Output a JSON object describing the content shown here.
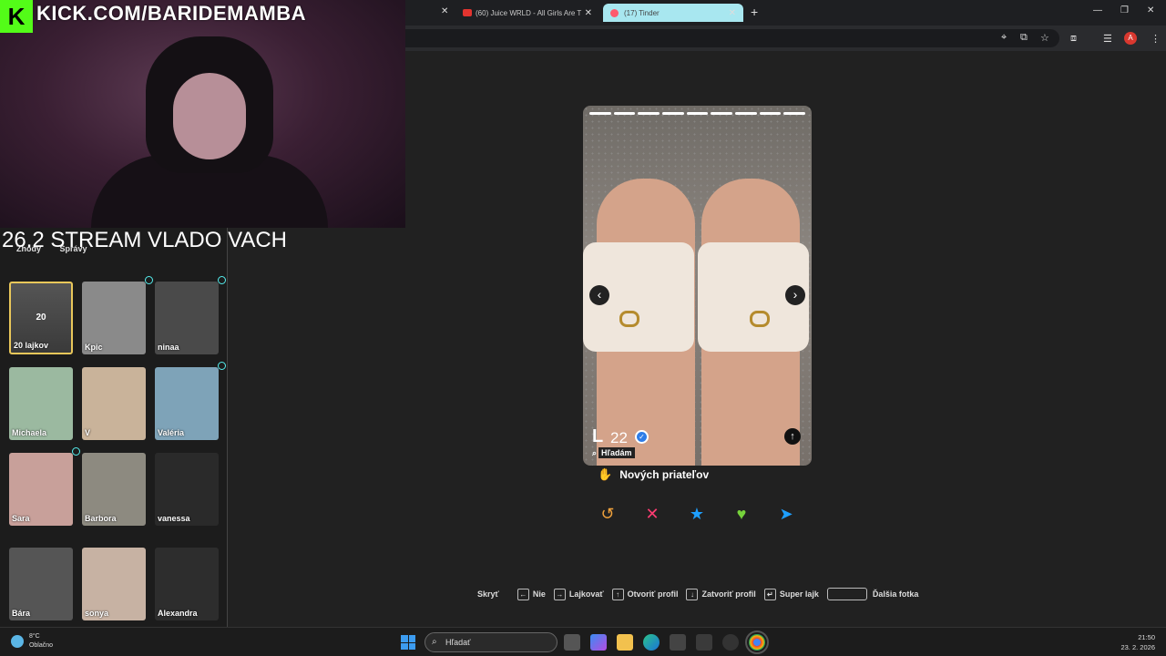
{
  "stream": {
    "kick_url": "KICK.COM/BARIDEMAMBA",
    "title": "26.2 STREAM VLADO VACH"
  },
  "browser": {
    "tabs": [
      {
        "label": "(60) Juice WRLD - All Girls Are T",
        "icon": "youtube-icon"
      },
      {
        "label": "(17) Tinder",
        "icon": "tinder-icon",
        "active": true
      }
    ],
    "new_tab": "+",
    "close": "✕",
    "profile_initial": "A"
  },
  "sidebar": {
    "tabs": [
      "Zhody",
      "Správy"
    ],
    "likes_tile": {
      "count": "20",
      "label": "20 lajkov"
    },
    "matches": [
      {
        "name": "Kpic",
        "color": "#8a8a8a"
      },
      {
        "name": "ninaa",
        "color": "#4a4a4a"
      },
      {
        "name": "Michaela",
        "color": "#9bb9a0"
      },
      {
        "name": "V",
        "color": "#c9b39a"
      },
      {
        "name": "Valéria",
        "color": "#7ea3b8"
      },
      {
        "name": "Sara",
        "color": "#c8a09a"
      },
      {
        "name": "Barbora",
        "color": "#8d8a80"
      },
      {
        "name": "vanessa",
        "color": "#2a2a2a"
      },
      {
        "name": "Bára",
        "color": "#555"
      },
      {
        "name": "sonya",
        "color": "#c7b2a3"
      },
      {
        "name": "Alexandra",
        "color": "#2d2d2d"
      }
    ]
  },
  "card": {
    "name": "L",
    "age": "22",
    "photo_count": 9,
    "search_label": "Hľadám",
    "looking_for": "Nových priateľov",
    "prev": "‹",
    "next": "›",
    "info": "↑"
  },
  "actions": [
    {
      "name": "rewind",
      "glyph": "↺",
      "color": "#f1a23c"
    },
    {
      "name": "nope",
      "glyph": "✕",
      "color": "#fe3c72"
    },
    {
      "name": "super-like",
      "glyph": "★",
      "color": "#1ea0ff"
    },
    {
      "name": "like",
      "glyph": "♥",
      "color": "#76d23b"
    },
    {
      "name": "boost",
      "glyph": "➤",
      "color": "#1ea0ff"
    }
  ],
  "shortcuts": {
    "hide": "Skryť",
    "items": [
      {
        "key": "←",
        "label": "Nie"
      },
      {
        "key": "→",
        "label": "Lajkovať"
      },
      {
        "key": "↑",
        "label": "Otvoriť profil"
      },
      {
        "key": "↓",
        "label": "Zatvoriť profil"
      },
      {
        "key": "↵",
        "label": "Super lajk"
      }
    ],
    "next_photo": "Ďalšia fotka"
  },
  "taskbar": {
    "weather_temp": "8°C",
    "weather_desc": "Oblačno",
    "search_placeholder": "Hľadať",
    "time": "21:50",
    "date": "23. 2. 2026"
  }
}
